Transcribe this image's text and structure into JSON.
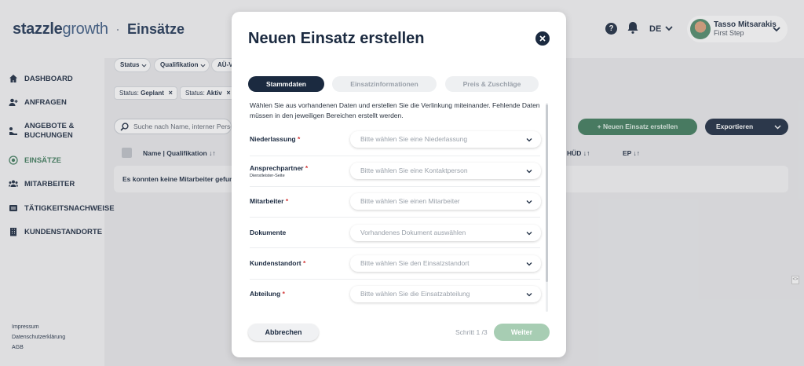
{
  "header": {
    "logo_bold": "stazzle",
    "logo_light": "growth",
    "separator": "·",
    "page_title": "Einsätze",
    "help_glyph": "?",
    "language": "DE",
    "user_name": "Tasso Mitsarakis",
    "user_company": "First Step"
  },
  "sidebar": {
    "items": [
      {
        "label": "DASHBOARD",
        "icon": "home-icon"
      },
      {
        "label": "ANFRAGEN",
        "icon": "user-plus-icon"
      },
      {
        "label": "ANGEBOTE & BUCHUNGEN",
        "icon": "offer-icon"
      },
      {
        "label": "EINSÄTZE",
        "icon": "target-icon",
        "active": true
      },
      {
        "label": "MITARBEITER",
        "icon": "people-icon"
      },
      {
        "label": "TÄTIGKEITSNACHWEISE",
        "icon": "timesheet-icon"
      },
      {
        "label": "KUNDENSTANDORTE",
        "icon": "building-icon"
      }
    ],
    "footer": [
      "Impressum",
      "Datenschutzerklärung",
      "AGB"
    ]
  },
  "main": {
    "filters": [
      "Status",
      "Qualifikation",
      "AÜ-V"
    ],
    "active_tags": [
      {
        "key": "Status: ",
        "value": "Geplant"
      },
      {
        "key": "Status: ",
        "value": "Aktiv"
      }
    ],
    "tag_remove_glyph": "×",
    "search_placeholder": "Suche nach Name, interner Personalnummer",
    "new_button": "+ Neuen Einsatz erstellen",
    "export_button": "Exportieren",
    "columns": [
      "Name | Qualifikation ↓↑",
      "HÜD ↓↑",
      "EP ↓↑"
    ],
    "empty_text": "Es konnten keine Mitarbeiter gefunden werden",
    "side_handle": "<>"
  },
  "colors": {
    "brand_dark": "#1b2a40",
    "brand_green": "#3d7b5b",
    "required": "#d33a3a",
    "disabled_green": "#a7cdb3"
  },
  "modal": {
    "title": "Neuen Einsatz erstellen",
    "close_glyph": "×",
    "steps": [
      "Stammdaten",
      "Einsatzinformationen",
      "Preis & Zuschläge"
    ],
    "active_step": 0,
    "description": "Wählen Sie aus vorhandenen Daten und erstellen Sie die Verlinkung miteinander. Fehlende Daten müssen in den jeweiligen Bereichen erstellt werden.",
    "fields": [
      {
        "label": "Niederlassung",
        "required": "*",
        "sub": "",
        "placeholder": "Bitte wählen Sie eine Niederlassung"
      },
      {
        "label": "Ansprechpartner",
        "required": "*",
        "sub": "Dienstleister-Seite",
        "placeholder": "Bitte wählen Sie eine Kontaktperson"
      },
      {
        "label": "Mitarbeiter",
        "required": "*",
        "sub": "",
        "placeholder": "Bitte wählen Sie einen Mitarbeiter"
      },
      {
        "label": "Dokumente",
        "required": "",
        "sub": "",
        "placeholder": "Vorhandenes Dokument auswählen"
      },
      {
        "label": "Kundenstandort",
        "required": "*",
        "sub": "",
        "placeholder": "Bitte wählen Sie den Einsatzstandort"
      },
      {
        "label": "Abteilung",
        "required": "*",
        "sub": "",
        "placeholder": "Bitte wählen Sie die Einsatzabteilung"
      }
    ],
    "cancel_label": "Abbrechen",
    "step_indicator": "Schritt 1 /3",
    "next_label": "Weiter"
  }
}
